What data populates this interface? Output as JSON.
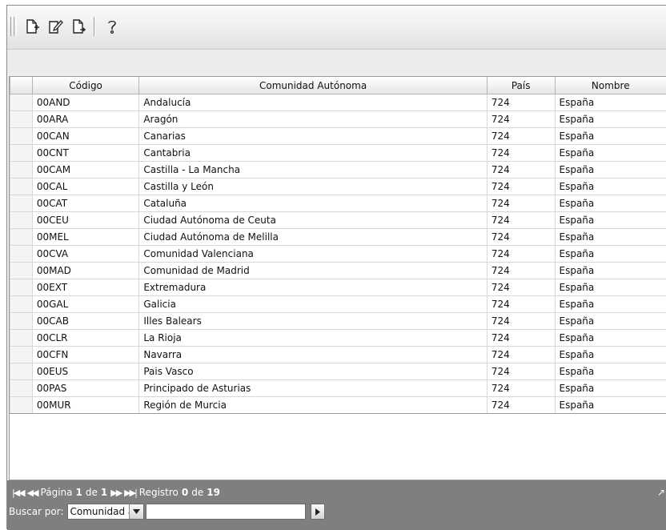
{
  "toolbar": {
    "icons": [
      "new-document-icon",
      "edit-document-icon",
      "export-document-icon",
      "help-icon"
    ],
    "help_glyph": "?"
  },
  "table": {
    "columns": [
      "Código",
      "Comunidad Autónoma",
      "País",
      "Nombre"
    ],
    "rows": [
      [
        "00AND",
        "Andalucía",
        "724",
        "España"
      ],
      [
        "00ARA",
        "Aragón",
        "724",
        "España"
      ],
      [
        "00CAN",
        "Canarias",
        "724",
        "España"
      ],
      [
        "00CNT",
        "Cantabria",
        "724",
        "España"
      ],
      [
        "00CAM",
        "Castilla - La Mancha",
        "724",
        "España"
      ],
      [
        "00CAL",
        "Castilla y León",
        "724",
        "España"
      ],
      [
        "00CAT",
        "Cataluña",
        "724",
        "España"
      ],
      [
        "00CEU",
        "Ciudad Autónoma de Ceuta",
        "724",
        "España"
      ],
      [
        "00MEL",
        "Ciudad Autónoma de Melilla",
        "724",
        "España"
      ],
      [
        "00CVA",
        "Comunidad Valenciana",
        "724",
        "España"
      ],
      [
        "00MAD",
        "Comunidad de Madrid",
        "724",
        "España"
      ],
      [
        "00EXT",
        "Extremadura",
        "724",
        "España"
      ],
      [
        "00GAL",
        "Galicia",
        "724",
        "España"
      ],
      [
        "00CAB",
        "Illes Balears",
        "724",
        "España"
      ],
      [
        "00CLR",
        "La Rioja",
        "724",
        "España"
      ],
      [
        "00CFN",
        "Navarra",
        "724",
        "España"
      ],
      [
        "00EUS",
        "Pais Vasco",
        "724",
        "España"
      ],
      [
        "00PAS",
        "Principado de Asturias",
        "724",
        "España"
      ],
      [
        "00MUR",
        "Región de Murcia",
        "724",
        "España"
      ]
    ]
  },
  "pager": {
    "first_glyph": "⏮",
    "prev_glyph": "◀◀",
    "page_label": "Página",
    "page_current": "1",
    "page_of": "de",
    "page_total": "1",
    "next_glyph": "▶▶",
    "last_glyph": "⏭",
    "record_label": "Registro",
    "record_current": "0",
    "record_of": "de",
    "record_total": "19"
  },
  "search": {
    "label": "Buscar por:",
    "field_value": "Comunidad au",
    "query_value": ""
  },
  "colors": {
    "pager_bg": "#7f7f7f",
    "toolbar_bg": "#e8e8e8"
  }
}
